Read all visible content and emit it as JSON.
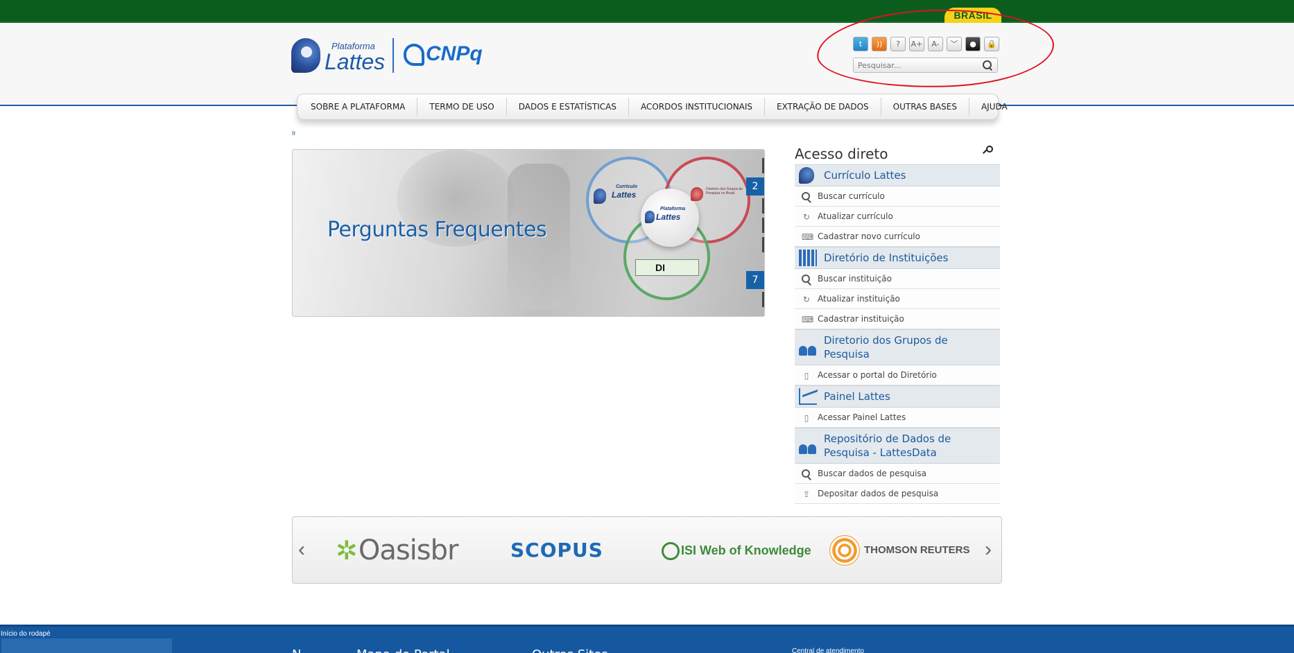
{
  "gov_bar": {
    "brasil_label": "BRASIL"
  },
  "header": {
    "logo_lattes_top": "Plataforma",
    "logo_lattes_name": "Lattes",
    "logo_cnpq": "CNPq"
  },
  "toolbar": {
    "icons": [
      {
        "name": "twitter-icon",
        "glyph": "t"
      },
      {
        "name": "rss-icon",
        "glyph": "))"
      },
      {
        "name": "help-icon",
        "glyph": "?"
      },
      {
        "name": "font-increase-icon",
        "glyph": "A+"
      },
      {
        "name": "font-decrease-icon",
        "glyph": "A-"
      },
      {
        "name": "chevron-down-icon",
        "glyph": "﹀"
      },
      {
        "name": "contrast-icon",
        "glyph": "●"
      },
      {
        "name": "lock-icon",
        "glyph": "🔒"
      }
    ],
    "search_placeholder": "Pesquisar..."
  },
  "nav": {
    "items": [
      "SOBRE A PLATAFORMA",
      "TERMO DE USO",
      "DADOS E ESTATÍSTICAS",
      "ACORDOS INSTITUCIONAIS",
      "EXTRAÇÃO DE DADOS",
      "OUTRAS BASES",
      "AJUDA"
    ]
  },
  "skip_link": "Ir",
  "banner": {
    "title": "Perguntas Frequentes",
    "slide_numbers": [
      "2",
      "7"
    ],
    "mini_curriculo": "Currículo",
    "mini_lattes": "Lattes",
    "mini_plataforma": "Plataforma",
    "mini_dgp": "Diretório dos Grupos de Pesquisa no Brasil",
    "mini_di": "DI"
  },
  "acesso": {
    "title": "Acesso direto",
    "sections": [
      {
        "title": "Currículo Lattes",
        "links": [
          "Buscar currículo",
          "Atualizar currículo",
          "Cadastrar novo currículo"
        ]
      },
      {
        "title": "Diretório de Instituições",
        "links": [
          "Buscar instituição",
          "Atualizar instituição",
          "Cadastrar instituição"
        ]
      },
      {
        "title": "Diretorio dos Grupos de Pesquisa",
        "links": [
          "Acessar o portal do Diretório"
        ]
      },
      {
        "title": "Painel Lattes",
        "links": [
          "Acessar Painel Lattes"
        ]
      },
      {
        "title": "Repositório de Dados de Pesquisa - LattesData",
        "links": [
          "Buscar dados de pesquisa",
          "Depositar dados de pesquisa"
        ]
      }
    ]
  },
  "partners": {
    "oasis": "Oasisbr",
    "scopus": "SCOPUS",
    "isi": "ISI Web of Knowledge",
    "thomson": "THOMSON REUTERS"
  },
  "footer": {
    "label": "Início do rodapé",
    "heading1": "N",
    "heading2": "Mapa do Portal",
    "heading3": "Outros Sites",
    "central": "Central de atendimento"
  },
  "colors": {
    "gov_green": "#0b5d1e",
    "brasil_yellow": "#f7d117",
    "brand_blue": "#1c5a9c",
    "footer_blue": "#1558a0",
    "annotation_red": "#e01020"
  }
}
